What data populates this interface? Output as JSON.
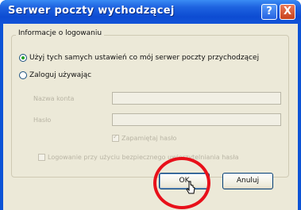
{
  "window": {
    "title": "Serwer poczty wychodzącej",
    "help_glyph": "?",
    "close_glyph": "X"
  },
  "group": {
    "label": "Informacje o logowaniu"
  },
  "options": {
    "same_settings": {
      "label": "Użyj tych samych ustawień co mój serwer poczty przychodzącej",
      "selected": true
    },
    "login_using": {
      "label": "Zaloguj używając",
      "selected": false
    }
  },
  "fields": {
    "account_name": {
      "label": "Nazwa konta",
      "value": "",
      "enabled": false
    },
    "password": {
      "label": "Hasło",
      "value": "",
      "enabled": false
    }
  },
  "checkboxes": {
    "remember_password": {
      "label": "Zapamiętaj hasło",
      "checked": true,
      "enabled": false
    },
    "secure_password_auth": {
      "label": "Logowanie przy użyciu bezpiecznego uwierzytelniania hasła",
      "checked": false,
      "enabled": false
    }
  },
  "buttons": {
    "ok_label": "OK",
    "cancel_label": "Anuluj"
  },
  "colors": {
    "title_bar": "#0c53d6",
    "dialog_bg": "#ece9d8",
    "highlight_ring": "#e8101a"
  }
}
